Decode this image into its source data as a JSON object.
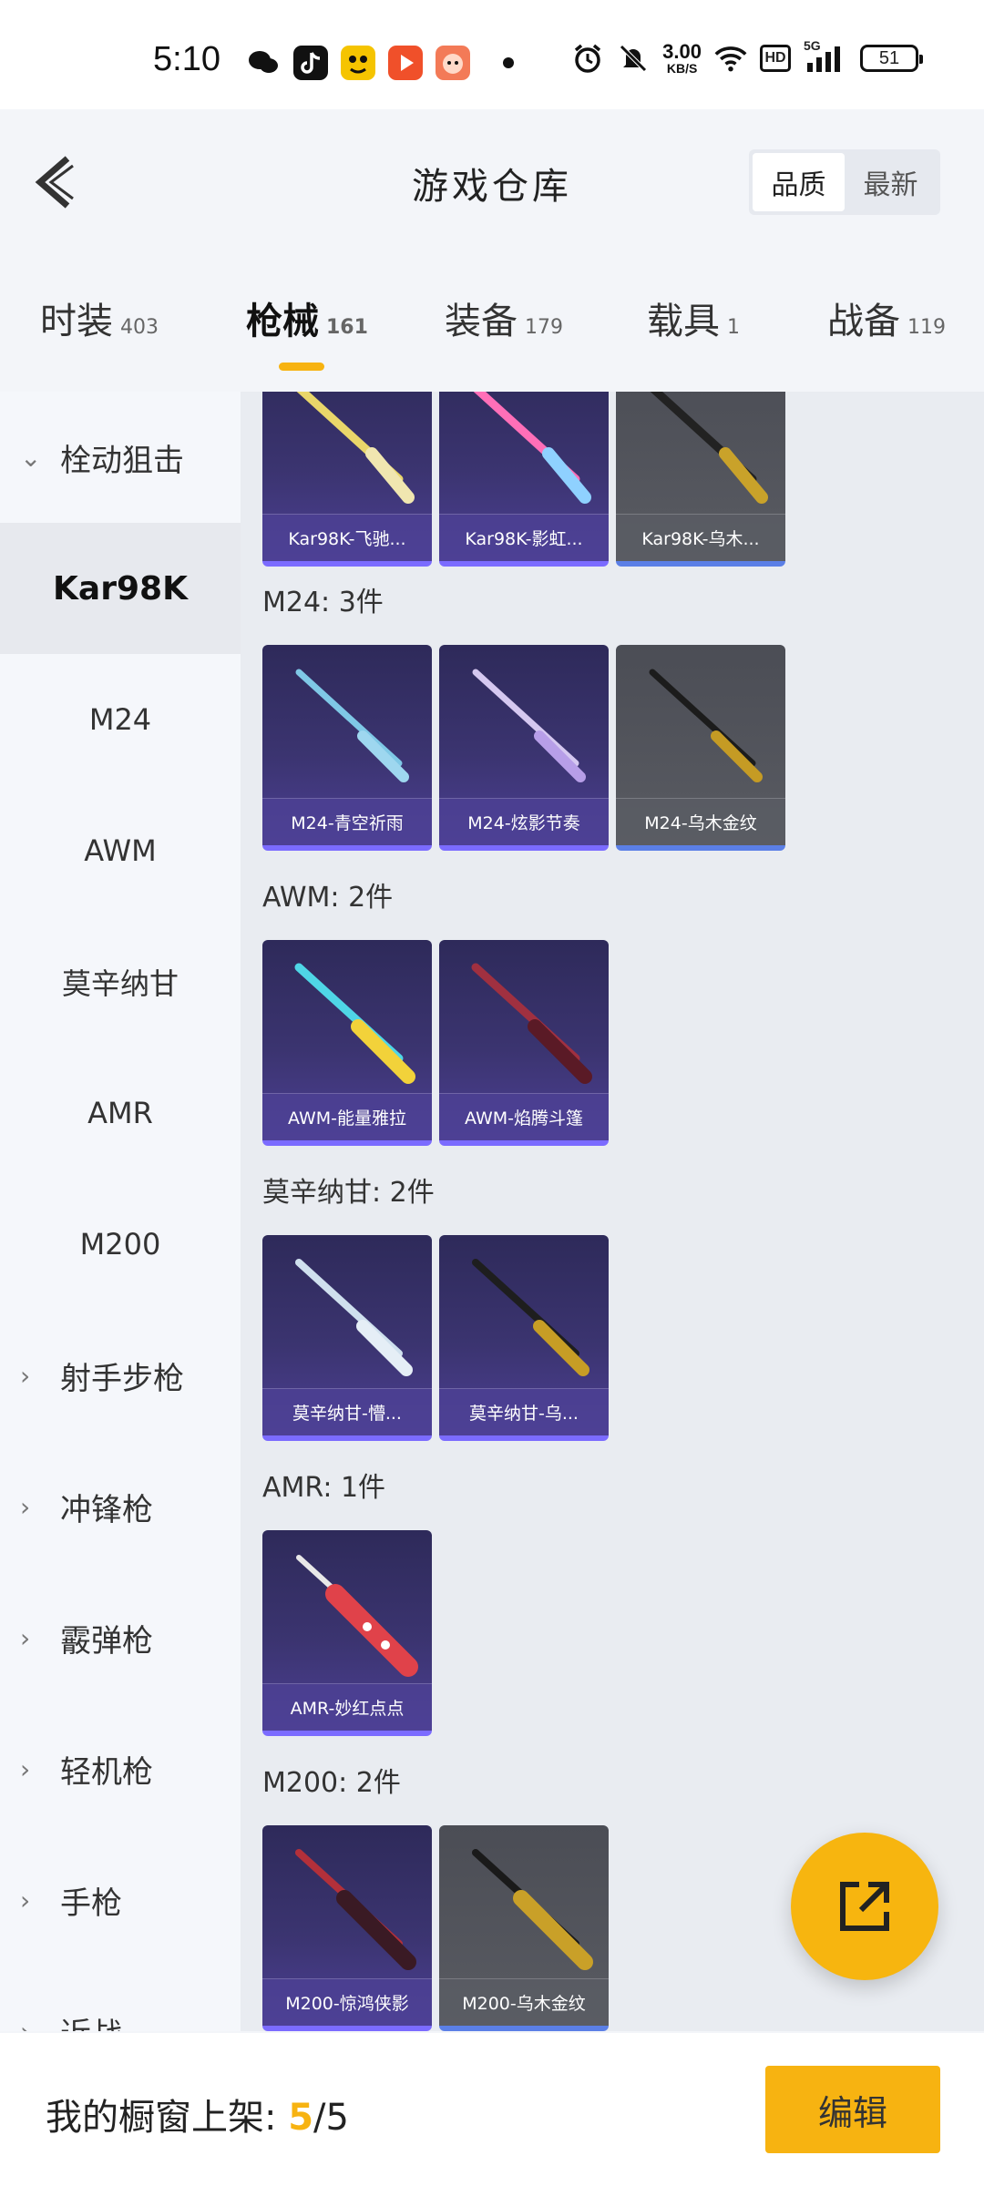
{
  "status_bar": {
    "time": "5:10",
    "net_speed_value": "3.00",
    "net_speed_unit": "KB/S",
    "hd": "HD",
    "signal": "5G",
    "battery": "51"
  },
  "header": {
    "title": "游戏仓库",
    "sort_options": [
      "品质",
      "最新"
    ],
    "sort_active": "品质"
  },
  "tabs": [
    {
      "label": "时装",
      "count": "403"
    },
    {
      "label": "枪械",
      "count": "161"
    },
    {
      "label": "装备",
      "count": "179"
    },
    {
      "label": "载具",
      "count": "1"
    },
    {
      "label": "战备",
      "count": "119"
    }
  ],
  "active_tab": "枪械",
  "sidebar": {
    "category_open": "栓动狙击",
    "subitems": [
      "Kar98K",
      "M24",
      "AWM",
      "莫辛纳甘",
      "AMR",
      "M200"
    ],
    "active_subitem": "Kar98K",
    "categories": [
      "射手步枪",
      "冲锋枪",
      "霰弹枪",
      "轻机枪",
      "手枪",
      "近战"
    ]
  },
  "sections": {
    "kar98k": {
      "cards": [
        "Kar98K-飞驰...",
        "Kar98K-影虹...",
        "Kar98K-乌木..."
      ]
    },
    "m24": {
      "title": "M24: 3件",
      "cards": [
        "M24-青空祈雨",
        "M24-炫影节奏",
        "M24-乌木金纹"
      ]
    },
    "awm": {
      "title": "AWM: 2件",
      "cards": [
        "AWM-能量雅拉",
        "AWM-焰腾斗篷"
      ]
    },
    "mosin": {
      "title": "莫辛纳甘: 2件",
      "cards": [
        "莫辛纳甘-懵...",
        "莫辛纳甘-乌..."
      ]
    },
    "amr": {
      "title": "AMR: 1件",
      "cards": [
        "AMR-妙红点点"
      ]
    },
    "m200": {
      "title": "M200: 2件",
      "cards": [
        "M200-惊鸿侠影",
        "M200-乌木金纹"
      ]
    }
  },
  "bottom_bar": {
    "label": "我的橱窗上架:",
    "count": "5",
    "total": "/5",
    "edit_button": "编辑"
  },
  "colors": {
    "accent": "#f7b311",
    "card_purple": "#3b3470",
    "card_gray": "#595b62"
  }
}
